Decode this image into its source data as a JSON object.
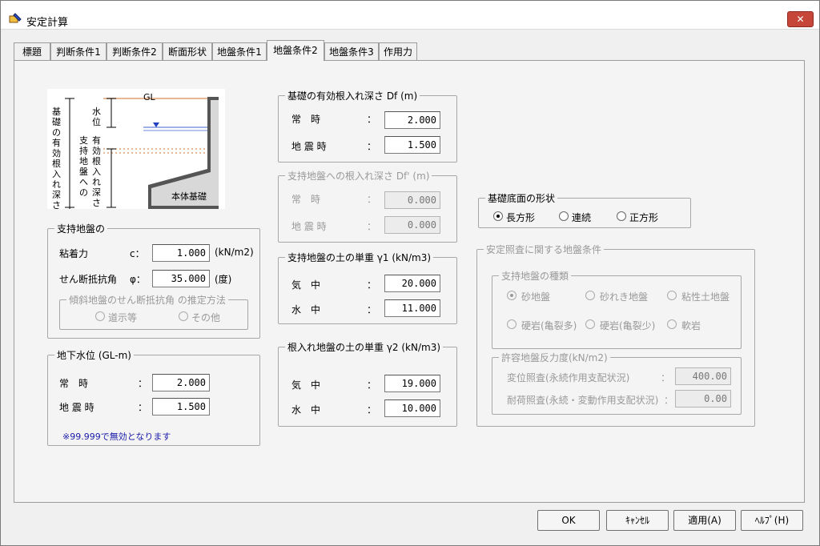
{
  "window": {
    "title": "安定計算",
    "close_label": "✕"
  },
  "tabs": [
    {
      "label": "標題"
    },
    {
      "label": "判断条件1"
    },
    {
      "label": "判断条件2"
    },
    {
      "label": "断面形状"
    },
    {
      "label": "地盤条件1"
    },
    {
      "label": "地盤条件2"
    },
    {
      "label": "地盤条件3"
    },
    {
      "label": "作用力"
    }
  ],
  "diagram": {
    "gl": "GL",
    "water_level": "水位",
    "left_label": "基礎の有効根入れ深さ",
    "middle_label": "有効根入れ深さ",
    "right_label": "支持地盤への",
    "body_label": "本体基礎"
  },
  "support_ground": {
    "title": "支持地盤の",
    "cohesion_label": "粘着力",
    "cohesion_symbol": "c：",
    "cohesion_value": "1.000",
    "cohesion_unit": "(kN/m2)",
    "friction_label": "せん断抵抗角",
    "friction_symbol": "φ：",
    "friction_value": "35.000",
    "friction_unit": "(度)",
    "sub_title": "傾斜地盤のせん断抵抗角 の推定方法",
    "option1": "道示等",
    "option2": "その他"
  },
  "groundwater": {
    "title": "地下水位 (GL-m)",
    "normal_label": "常　時",
    "normal_value": "2.000",
    "quake_label": "地 震 時",
    "quake_value": "1.500",
    "note": "※99.999で無効となります"
  },
  "df": {
    "title": "基礎の有効根入れ深さ Df (m)",
    "normal_label": "常　時",
    "normal_value": "2.000",
    "quake_label": "地 震 時",
    "quake_value": "1.500"
  },
  "df2": {
    "title": "支持地盤への根入れ深さ Df' (m)",
    "normal_label": "常　時",
    "normal_value": "0.000",
    "quake_label": "地 震 時",
    "quake_value": "0.000"
  },
  "gamma1": {
    "title": "支持地盤の土の単重 γ1 (kN/m3)",
    "air_label": "気　中",
    "air_value": "20.000",
    "water_label": "水　中",
    "water_value": "11.000"
  },
  "gamma2": {
    "title": "根入れ地盤の土の単重 γ2 (kN/m3)",
    "air_label": "気　中",
    "air_value": "19.000",
    "water_label": "水　中",
    "water_value": "10.000"
  },
  "shape": {
    "title": "基礎底面の形状",
    "opt1": "長方形",
    "opt2": "連続",
    "opt3": "正方形",
    "selected": "長方形"
  },
  "stability": {
    "title": "安定照査に関する地盤条件",
    "kind_title": "支持地盤の種類",
    "kind_opts": [
      "砂地盤",
      "砂れき地盤",
      "粘性土地盤",
      "硬岩(亀裂多)",
      "硬岩(亀裂少)",
      "軟岩"
    ],
    "kind_selected": "砂地盤",
    "reaction_title": "許容地盤反力度(kN/m2)",
    "disp_label": "変位照査(永続作用支配状況)",
    "disp_value": "400.00",
    "load_label": "耐荷照査(永続・変動作用支配状況)",
    "load_value": "0.00"
  },
  "buttons": {
    "ok": "OK",
    "cancel": "ｷｬﾝｾﾙ",
    "apply": "適用(A)",
    "help": "ﾍﾙﾌﾟ(H)"
  },
  "colon": "："
}
